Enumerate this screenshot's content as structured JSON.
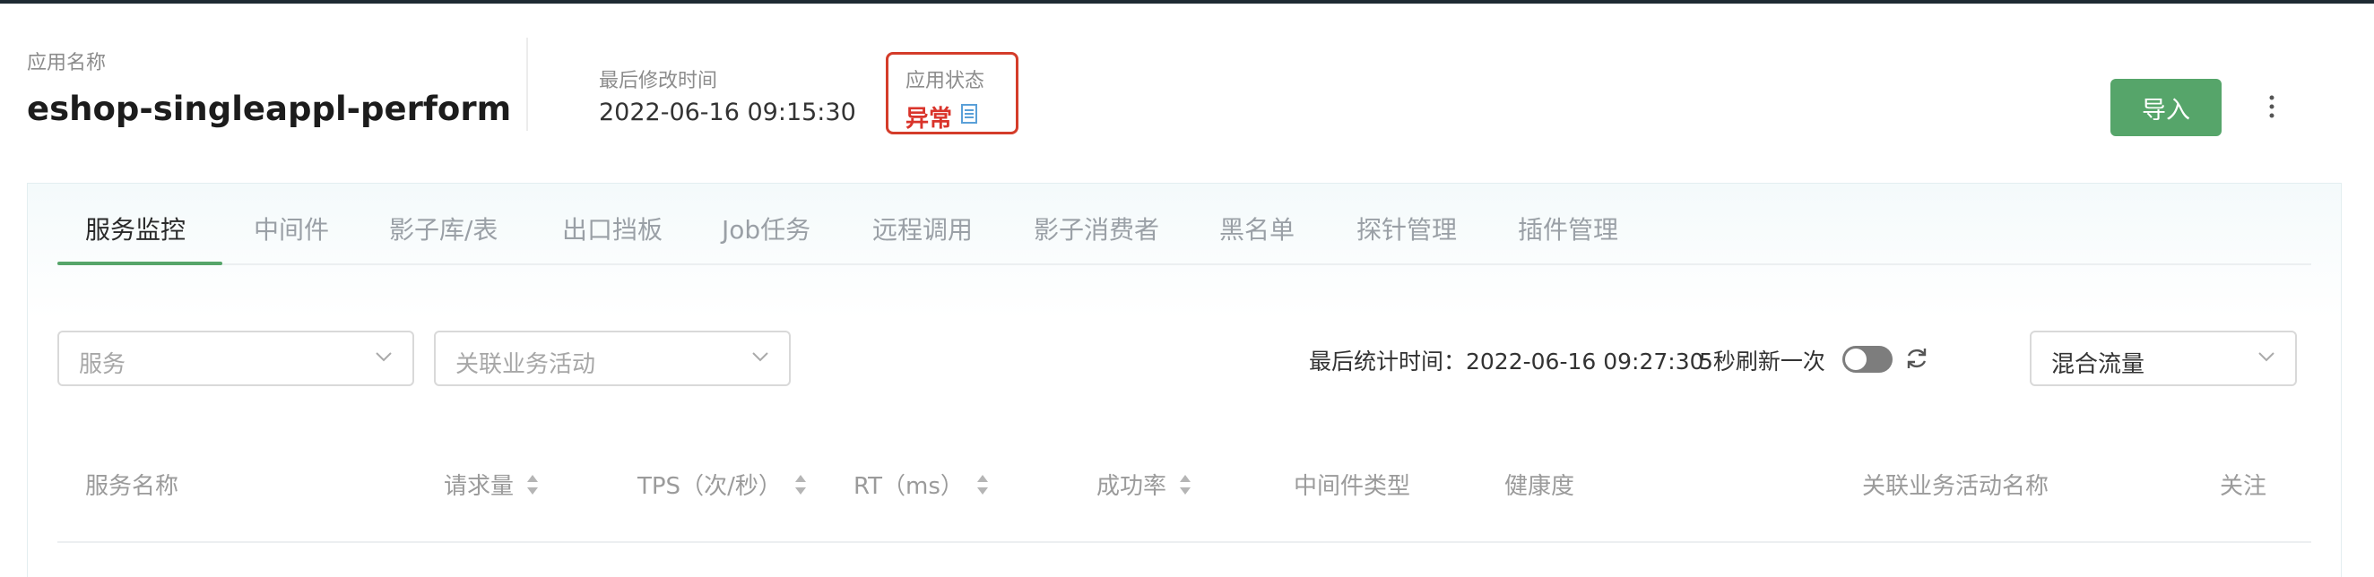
{
  "header": {
    "app_name_label": "应用名称",
    "app_name": "eshop-singleappl-perform",
    "last_modified_label": "最后修改时间",
    "last_modified": "2022-06-16 09:15:30",
    "status_label": "应用状态",
    "status_value": "异常",
    "import_button": "导入"
  },
  "colors": {
    "accent_green": "#56a56a",
    "status_error": "#d9342b",
    "highlight_border": "#d43c2a"
  },
  "tabs": [
    {
      "label": "服务监控",
      "active": true
    },
    {
      "label": "中间件"
    },
    {
      "label": "影子库/表"
    },
    {
      "label": "出口挡板"
    },
    {
      "label": "Job任务"
    },
    {
      "label": "远程调用"
    },
    {
      "label": "影子消费者"
    },
    {
      "label": "黑名单"
    },
    {
      "label": "探针管理"
    },
    {
      "label": "插件管理"
    }
  ],
  "filters": {
    "service_placeholder": "服务",
    "activity_placeholder": "关联业务活动",
    "last_stat_time": "最后统计时间：2022-06-16 09:27:30",
    "refresh_label": "5秒刷新一次",
    "auto_refresh_on": false,
    "traffic_type": "混合流量"
  },
  "table": {
    "columns": [
      "服务名称",
      "请求量",
      "TPS（次/秒）",
      "RT（ms）",
      "成功率",
      "中间件类型",
      "健康度",
      "关联业务活动名称",
      "关注"
    ]
  },
  "icons": [
    "document-icon",
    "more-vertical-icon",
    "chevron-down-icon",
    "refresh-icon",
    "sort-icon"
  ]
}
